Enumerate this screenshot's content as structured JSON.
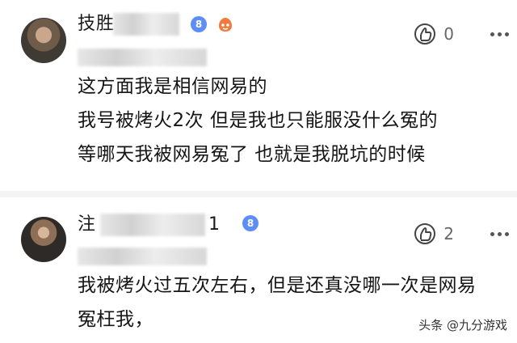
{
  "comments": [
    {
      "username_visible": "技胜",
      "level": "8",
      "likes": "0",
      "lines": [
        "这方面我是相信网易的",
        "我号被烤火2次 但是我也只能服没什么冤的",
        "等哪天我被网易冤了 也就是我脱坑的时候"
      ]
    },
    {
      "username_visible": "注",
      "username_suffix": "1",
      "level": "8",
      "likes": "2",
      "lines": [
        "我被烤火过五次左右，但是还真没哪一次是网易",
        "冤枉我，"
      ]
    }
  ],
  "watermark": "头条 @九分游戏",
  "icons": {
    "like": "like-hand-icon",
    "more": "more-dots-icon",
    "level_badge": "level-badge-icon",
    "vip": "vip-badge-icon"
  },
  "colors": {
    "level_badge": "#5d8ef5",
    "vip_badge": "#f07b3f",
    "separator": "#f4f4f4"
  }
}
